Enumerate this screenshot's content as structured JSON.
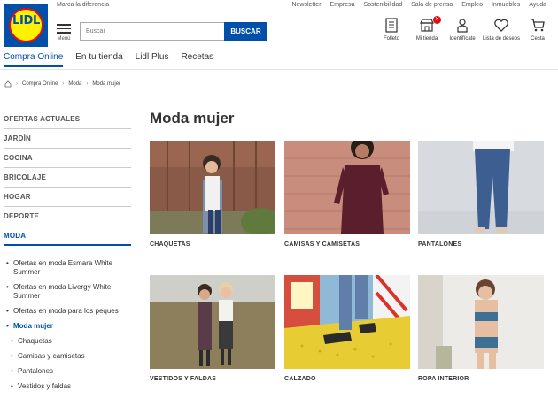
{
  "brand": {
    "logo_text": "LIDL",
    "tagline": "Marca la diferencia",
    "colors": {
      "blue": "#0050aa",
      "yellow": "#fff100",
      "red": "#e60a14"
    }
  },
  "top_links": [
    "Newsletter",
    "Empresa",
    "Sostenibilidad",
    "Sala de prensa",
    "Empleo",
    "Inmuebles",
    "Ayuda"
  ],
  "header": {
    "menu_label": "Menú",
    "search": {
      "placeholder": "Buscar",
      "button": "BUSCAR"
    },
    "actions": [
      {
        "label": "Folleto",
        "icon": "flyer-icon"
      },
      {
        "label": "Mi tienda",
        "icon": "store-icon"
      },
      {
        "label": "Identifícate",
        "icon": "user-icon"
      },
      {
        "label": "Lista de deseos",
        "icon": "heart-icon"
      },
      {
        "label": "Cesta",
        "icon": "cart-icon"
      }
    ]
  },
  "main_nav": [
    "Compra Online",
    "En tu tienda",
    "Lidl Plus",
    "Recetas"
  ],
  "breadcrumb": [
    "Compra Online",
    "Moda",
    "Moda mujer"
  ],
  "sidebar": {
    "categories": [
      "OFERTAS ACTUALES",
      "JARDÍN",
      "COCINA",
      "BRICOLAJE",
      "HOGAR",
      "DEPORTE",
      "MODA"
    ],
    "moda_items": [
      "Ofertas en moda Esmara White Summer",
      "Ofertas en moda Livergy White Summer",
      "Ofertas en moda para los peques",
      "Moda mujer"
    ],
    "moda_mujer_items": [
      "Chaquetas",
      "Camisas y camisetas",
      "Pantalones",
      "Vestidos y faldas"
    ]
  },
  "page_title": "Moda mujer",
  "tiles": [
    "CHAQUETAS",
    "CAMISAS Y CAMISETAS",
    "PANTALONES",
    "VESTIDOS Y FALDAS",
    "CALZADO",
    "ROPA INTERIOR"
  ]
}
